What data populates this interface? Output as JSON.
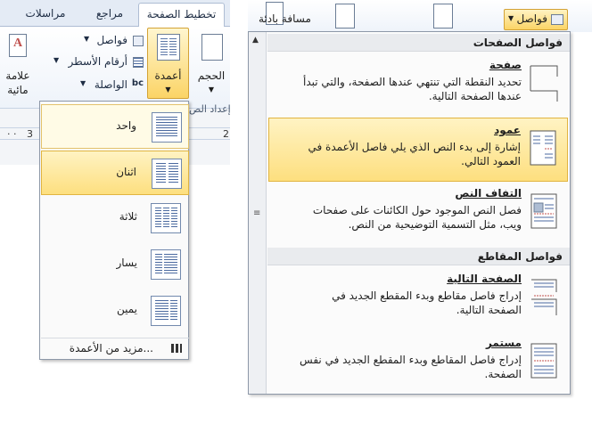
{
  "ribbon": {
    "tabs": [
      {
        "label": "تخطيط الصفحة"
      },
      {
        "label": "مراجع"
      },
      {
        "label": "مراسلات"
      }
    ],
    "columns_button": {
      "label": "أعمدة"
    },
    "size_button": {
      "label": "الحجم"
    },
    "watermark_button": {
      "label_line1": "علامة",
      "label_line2": "مائية"
    },
    "breaks_small": {
      "label": "فواصل"
    },
    "line_numbers": {
      "label": "أرقام الأسطر"
    },
    "hyphenation": {
      "label": "الواصلة"
    },
    "group_label": "إعداد الص",
    "ruler": {
      "left_num": "3",
      "right_num": "2"
    }
  },
  "columns_menu": {
    "items": [
      {
        "label": "واحد",
        "cols": 1
      },
      {
        "label": "اثنان",
        "cols": 2
      },
      {
        "label": "ثلاثة",
        "cols": 3
      },
      {
        "label": "يسار",
        "cols": 2
      },
      {
        "label": "يمين",
        "cols": 2
      }
    ],
    "more": "مزيد من الأعمدة..."
  },
  "ribbon2": {
    "breaks_button": {
      "label": "فواصل"
    },
    "spacing_label": "مسافة بادئة"
  },
  "breaks_menu": {
    "page_breaks_header": "فواصل الصفحات",
    "section_breaks_header": "فواصل المقاطع",
    "items": [
      {
        "title": "صفحة",
        "desc": "تحديد النقطة التي تنتهي عندها الصفحة، والتي تبدأ عندها الصفحة التالية."
      },
      {
        "title": "عمود",
        "desc": "إشارة إلى بدء النص الذي يلي فاصل الأعمدة في العمود التالي."
      },
      {
        "title": "التفاف النص",
        "desc": "فصل النص الموجود حول الكائنات على صفحات ويب، مثل التسمية التوضيحية من النص."
      },
      {
        "title": "الصفحة التالية",
        "desc": "إدراج فاصل مقاطع وبدء المقطع الجديد في الصفحة التالية."
      },
      {
        "title": "مستمر",
        "desc": "إدراج فاصل المقاطع وبدء المقطع الجديد في نفس الصفحة."
      }
    ]
  },
  "colors": {
    "accent_hover": "#fddf7f",
    "accent_border": "#e1b440",
    "menu_bg": "#fbfbfb"
  }
}
